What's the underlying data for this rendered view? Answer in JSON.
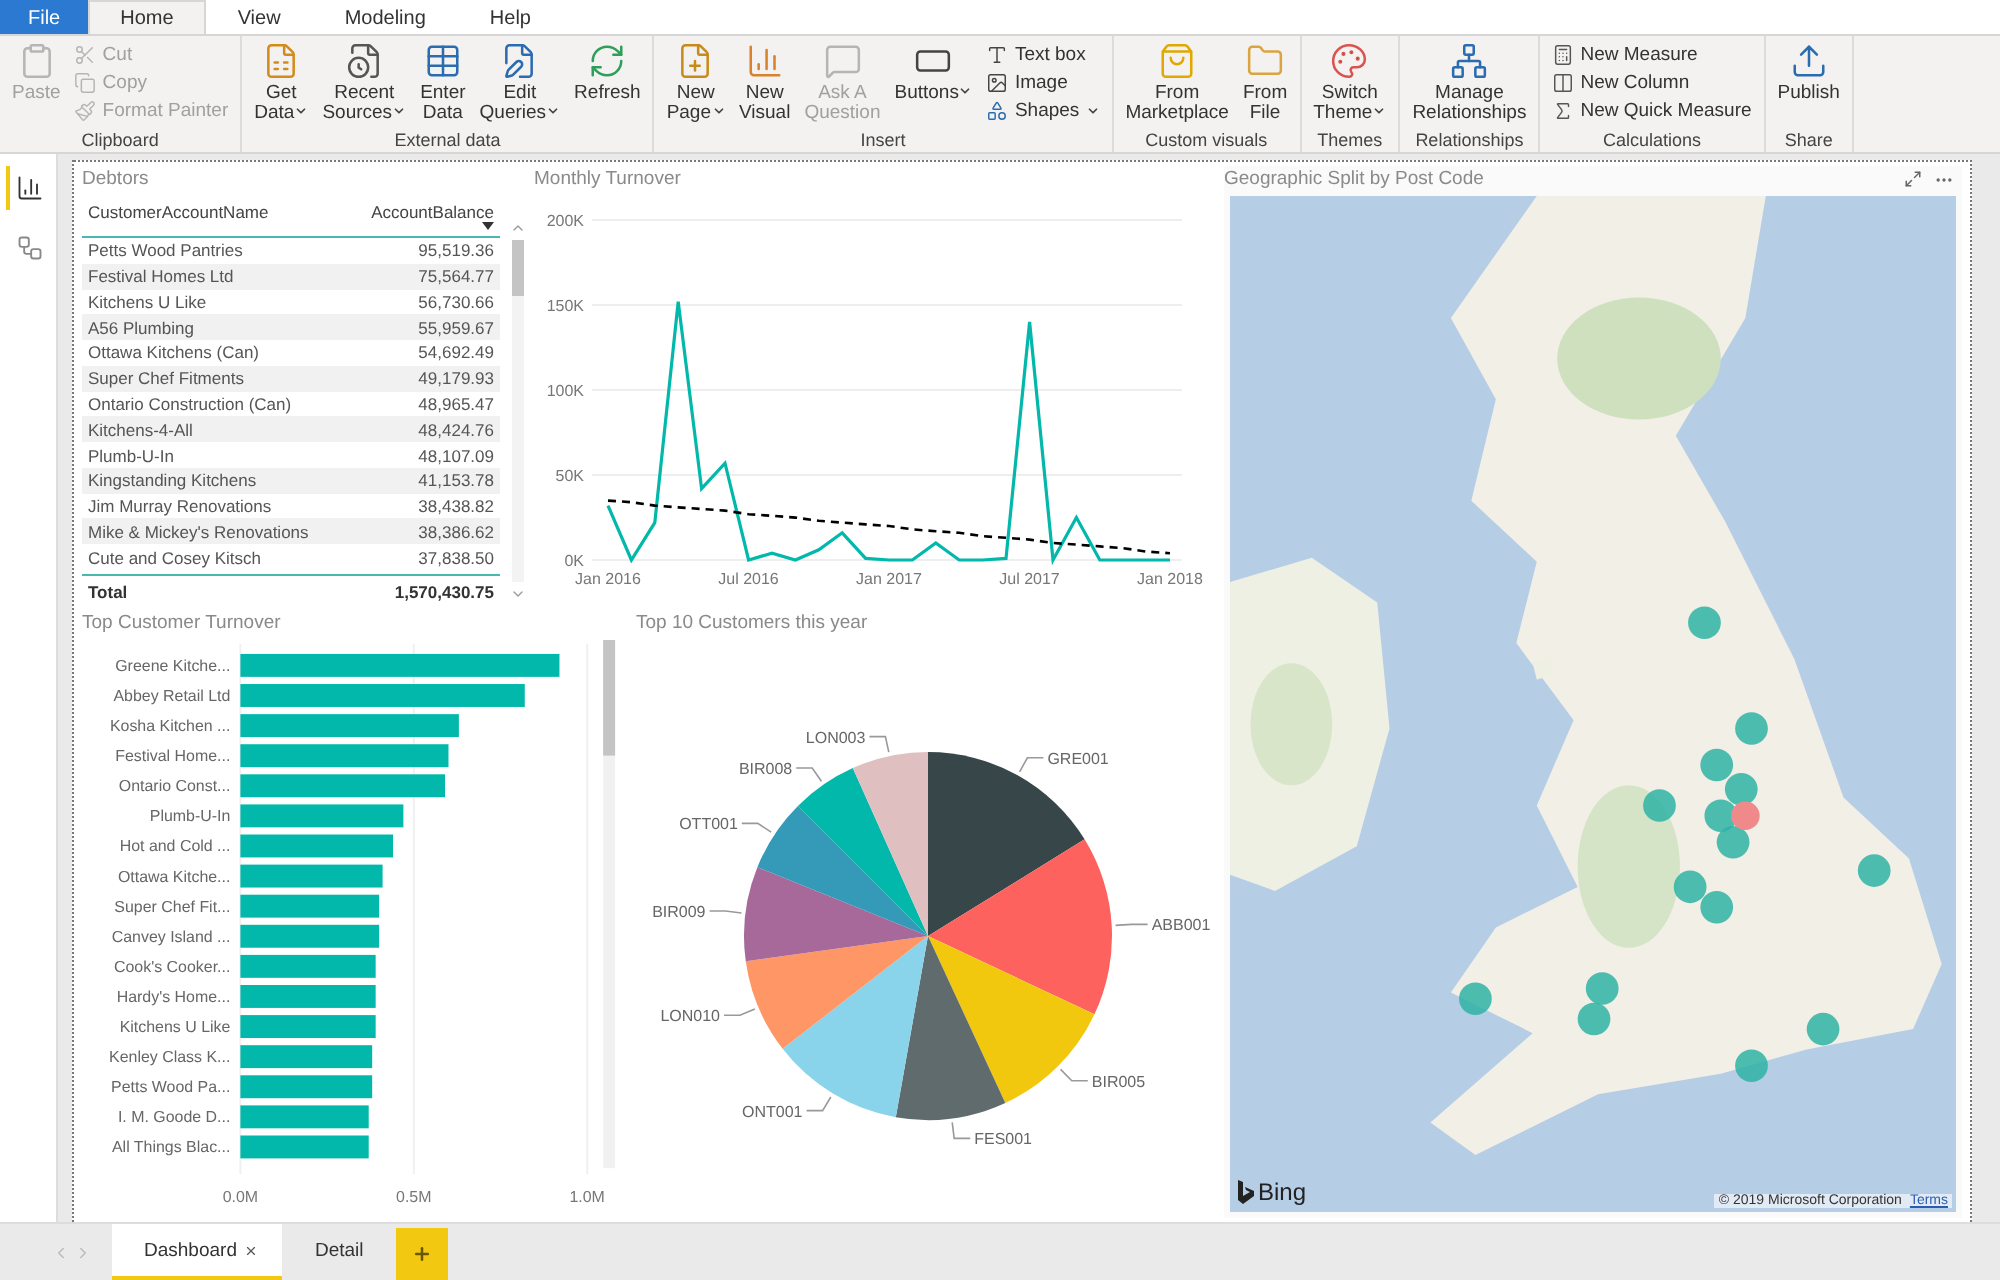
{
  "ribbon": {
    "tabs": [
      {
        "label": "File",
        "kind": "file",
        "selected": false
      },
      {
        "label": "Home",
        "kind": "tab",
        "selected": true
      },
      {
        "label": "View",
        "kind": "tab",
        "selected": false
      },
      {
        "label": "Modeling",
        "kind": "tab",
        "selected": false
      },
      {
        "label": "Help",
        "kind": "tab",
        "selected": false
      }
    ],
    "groups": [
      {
        "label": "Clipboard",
        "items": [
          {
            "label": [
              "Paste"
            ],
            "kind": "large",
            "disabled": true,
            "dropdown": false
          },
          {
            "label": [
              "Cut"
            ],
            "kind": "small",
            "disabled": true,
            "dropdown": false
          },
          {
            "label": [
              "Copy"
            ],
            "kind": "small",
            "disabled": true,
            "dropdown": false
          },
          {
            "label": [
              "Format Painter"
            ],
            "kind": "small",
            "disabled": true,
            "dropdown": false
          }
        ]
      },
      {
        "label": "External data",
        "items": [
          {
            "label": [
              "Get",
              "Data"
            ],
            "kind": "large",
            "disabled": false,
            "dropdown": true
          },
          {
            "label": [
              "Recent",
              "Sources"
            ],
            "kind": "large",
            "disabled": false,
            "dropdown": true
          },
          {
            "label": [
              "Enter",
              "Data"
            ],
            "kind": "large",
            "disabled": false,
            "dropdown": false
          },
          {
            "label": [
              "Edit",
              "Queries"
            ],
            "kind": "large",
            "disabled": false,
            "dropdown": true
          },
          {
            "label": [
              "Refresh"
            ],
            "kind": "large",
            "disabled": false,
            "dropdown": false
          }
        ]
      },
      {
        "label": "Insert",
        "items": [
          {
            "label": [
              "New",
              "Page"
            ],
            "kind": "large",
            "disabled": false,
            "dropdown": true
          },
          {
            "label": [
              "New",
              "Visual"
            ],
            "kind": "large",
            "disabled": false,
            "dropdown": false
          },
          {
            "label": [
              "Ask A",
              "Question"
            ],
            "kind": "large",
            "disabled": true,
            "dropdown": false
          },
          {
            "label": [
              "Buttons"
            ],
            "kind": "large",
            "disabled": false,
            "dropdown": true
          },
          {
            "label": [
              "Text box"
            ],
            "kind": "small",
            "disabled": false,
            "dropdown": false
          },
          {
            "label": [
              "Image"
            ],
            "kind": "small",
            "disabled": false,
            "dropdown": false
          },
          {
            "label": [
              "Shapes"
            ],
            "kind": "small",
            "disabled": false,
            "dropdown": true
          }
        ]
      },
      {
        "label": "Custom visuals",
        "items": [
          {
            "label": [
              "From",
              "Marketplace"
            ],
            "kind": "large",
            "disabled": false,
            "dropdown": false
          },
          {
            "label": [
              "From",
              "File"
            ],
            "kind": "large",
            "disabled": false,
            "dropdown": false
          }
        ]
      },
      {
        "label": "Themes",
        "items": [
          {
            "label": [
              "Switch",
              "Theme"
            ],
            "kind": "large",
            "disabled": false,
            "dropdown": true
          }
        ]
      },
      {
        "label": "Relationships",
        "items": [
          {
            "label": [
              "Manage",
              "Relationships"
            ],
            "kind": "large",
            "disabled": false,
            "dropdown": false
          }
        ]
      },
      {
        "label": "Calculations",
        "items": [
          {
            "label": [
              "New Measure"
            ],
            "kind": "small",
            "disabled": false,
            "dropdown": false
          },
          {
            "label": [
              "New Column"
            ],
            "kind": "small",
            "disabled": false,
            "dropdown": false
          },
          {
            "label": [
              "New Quick Measure"
            ],
            "kind": "small",
            "disabled": false,
            "dropdown": false
          }
        ]
      },
      {
        "label": "Share",
        "items": [
          {
            "label": [
              "Publish"
            ],
            "kind": "large",
            "disabled": false,
            "dropdown": false
          }
        ]
      }
    ]
  },
  "rail": {
    "items": [
      {
        "selected": true
      },
      {
        "selected": false
      }
    ]
  },
  "debtors": {
    "title": "Debtors",
    "columns": [
      {
        "label": "CustomerAccountName",
        "sorted": false
      },
      {
        "label": "AccountBalance",
        "sorted": true
      }
    ],
    "rows": [
      [
        "Petts Wood Pantries",
        "95,519.36"
      ],
      [
        "Festival Homes Ltd",
        "75,564.77"
      ],
      [
        "Kitchens U Like",
        "56,730.66"
      ],
      [
        "A56 Plumbing",
        "55,959.67"
      ],
      [
        "Ottawa Kitchens (Can)",
        "54,692.49"
      ],
      [
        "Super Chef Fitments",
        "49,179.93"
      ],
      [
        "Ontario Construction (Can)",
        "48,965.47"
      ],
      [
        "Kitchens-4-All",
        "48,424.76"
      ],
      [
        "Plumb-U-In",
        "48,107.09"
      ],
      [
        "Kingstanding Kitchens",
        "41,153.78"
      ],
      [
        "Jim Murray Renovations",
        "38,438.82"
      ],
      [
        "Mike & Mickey's Renovations",
        "38,386.62"
      ],
      [
        "Cute and Cosey Kitsch",
        "37,838.50"
      ]
    ],
    "total": [
      "Total",
      "1,570,430.75"
    ]
  },
  "monthly_turnover": {
    "chart_data": {
      "type": "line",
      "title": "Monthly Turnover",
      "categories": [
        "Jan 2016",
        null,
        null,
        null,
        null,
        null,
        "Jul 2016",
        null,
        null,
        null,
        null,
        null,
        "Jan 2017",
        null,
        null,
        null,
        null,
        null,
        "Jul 2017",
        null,
        null,
        null,
        null,
        null,
        "Jan 2018"
      ],
      "series": [
        {
          "color": "#01b8aa",
          "line_style": "solid",
          "values": [
            32000,
            0,
            22000,
            152000,
            42000,
            57000,
            0,
            4000,
            0,
            6000,
            16000,
            1000,
            0,
            0,
            10000,
            0,
            0,
            1000,
            140000,
            0,
            25000,
            0,
            0,
            0,
            0
          ]
        },
        {
          "color": "#000000",
          "line_style": "dashed",
          "values": [
            35000,
            34000,
            32000,
            31000,
            30000,
            29000,
            27000,
            26000,
            25000,
            23000,
            22000,
            21000,
            20000,
            18000,
            17000,
            16000,
            14000,
            13000,
            12000,
            10000,
            9000,
            8000,
            7000,
            5000,
            4000
          ]
        }
      ],
      "grid": true,
      "ylim": [
        0,
        200000
      ],
      "yticks": [
        {
          "value": 0,
          "label": "0K"
        },
        {
          "value": 50000,
          "label": "50K"
        },
        {
          "value": 100000,
          "label": "100K"
        },
        {
          "value": 150000,
          "label": "150K"
        },
        {
          "value": 200000,
          "label": "200K"
        }
      ]
    }
  },
  "top_customer_turnover": {
    "chart_data": {
      "type": "bar",
      "orientation": "horizontal",
      "title": "Top Customer Turnover",
      "categories": [
        "Greene Kitche...",
        "Abbey Retail Ltd",
        "Kosha Kitchen ...",
        "Festival Home...",
        "Ontario Const...",
        "Plumb-U-In",
        "Hot and Cold ...",
        "Ottawa Kitche...",
        "Super Chef Fit...",
        "Canvey Island ...",
        "Cook's Cooker...",
        "Hardy's Home...",
        "Kitchens U Like",
        "Kenley Class K...",
        "Petts Wood Pa...",
        "I. M. Goode D...",
        "All Things Blac..."
      ],
      "series": [
        {
          "color": "#01b8aa",
          "values": [
            920000,
            820000,
            630000,
            600000,
            590000,
            470000,
            440000,
            410000,
            400000,
            400000,
            390000,
            390000,
            390000,
            380000,
            380000,
            370000,
            370000
          ]
        }
      ],
      "xlim": [
        0,
        1000000
      ],
      "xticks": [
        {
          "value": 0,
          "label": "0.0M"
        },
        {
          "value": 500000,
          "label": "0.5M"
        },
        {
          "value": 1000000,
          "label": "1.0M"
        }
      ]
    }
  },
  "top_customers": {
    "chart_data": {
      "type": "pie",
      "title": "Top 10 Customers this year",
      "categories": [
        "GRE001",
        "ABB001",
        "BIR005",
        "FES001",
        "ONT001",
        "LON010",
        "BIR009",
        "OTT001",
        "BIR008",
        "LON003"
      ],
      "values": [
        16.2,
        15.8,
        11.1,
        9.7,
        11.7,
        8.3,
        8.3,
        6.4,
        5.8,
        6.7
      ]
    }
  },
  "map": {
    "title": "Geographic Split by Post Code",
    "logo": "Bing",
    "copyright": "© 2019 Microsoft Corporation",
    "terms": "Terms"
  },
  "pages": {
    "tabs": [
      {
        "label": "Dashboard",
        "selected": true
      },
      {
        "label": "Detail",
        "selected": false
      }
    ]
  }
}
